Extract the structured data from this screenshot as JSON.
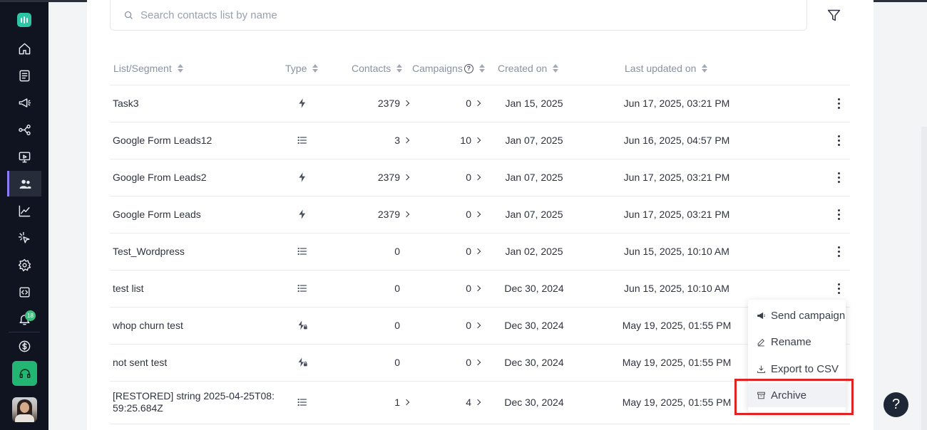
{
  "search": {
    "placeholder": "Search contacts list by name"
  },
  "sidebar": {
    "items": [
      "logo",
      "home",
      "templates",
      "campaigns",
      "automations",
      "pages",
      "contacts",
      "analytics",
      "integrations",
      "settings",
      "developer",
      "notifications",
      "billing",
      "support",
      "profile"
    ],
    "notification_count": "18",
    "active": "contacts"
  },
  "table": {
    "headers": {
      "name": "List/Segment",
      "type": "Type",
      "contacts": "Contacts",
      "campaigns": "Campaigns",
      "created": "Created on",
      "updated": "Last updated on"
    },
    "rows": [
      {
        "name": "Task3",
        "type": "bolt-icon",
        "contacts": "2379",
        "contacts_link": true,
        "campaigns": "0",
        "created": "Jan 15, 2025",
        "updated": "Jun 17, 2025, 03:21 PM"
      },
      {
        "name": "Google Form Leads12",
        "type": "list-icon",
        "contacts": "3",
        "contacts_link": true,
        "campaigns": "10",
        "created": "Jan 07, 2025",
        "updated": "Jun 16, 2025, 04:57 PM"
      },
      {
        "name": "Google From Leads2",
        "type": "bolt-icon",
        "contacts": "2379",
        "contacts_link": true,
        "campaigns": "0",
        "created": "Jan 07, 2025",
        "updated": "Jun 17, 2025, 03:21 PM"
      },
      {
        "name": "Google Form Leads",
        "type": "bolt-icon",
        "contacts": "2379",
        "contacts_link": true,
        "campaigns": "0",
        "created": "Jan 07, 2025",
        "updated": "Jun 17, 2025, 03:21 PM"
      },
      {
        "name": "Test_Wordpress",
        "type": "list-icon",
        "contacts": "0",
        "contacts_link": false,
        "campaigns": "0",
        "created": "Jan 02, 2025",
        "updated": "Jun 15, 2025, 10:10 AM"
      },
      {
        "name": "test list",
        "type": "list-icon",
        "contacts": "0",
        "contacts_link": false,
        "campaigns": "0",
        "created": "Dec 30, 2024",
        "updated": "Jun 15, 2025, 10:10 AM"
      },
      {
        "name": "whop churn test",
        "type": "bolt-lock-icon",
        "contacts": "0",
        "contacts_link": false,
        "campaigns": "0",
        "created": "Dec 30, 2024",
        "updated": "May 19, 2025, 01:55 PM"
      },
      {
        "name": "not sent test",
        "type": "bolt-lock-icon",
        "contacts": "0",
        "contacts_link": false,
        "campaigns": "0",
        "created": "Dec 30, 2024",
        "updated": "May 19, 2025, 01:55 PM"
      },
      {
        "name": "[RESTORED] string 2025-04-25T08: 59:25.684Z",
        "type": "list-icon",
        "contacts": "1",
        "contacts_link": true,
        "campaigns": "4",
        "created": "Dec 30, 2024",
        "updated": "May 19, 2025, 01:55 PM"
      }
    ]
  },
  "context_menu": {
    "items": [
      {
        "label": "Send campaign",
        "icon": "megaphone-icon"
      },
      {
        "label": "Rename",
        "icon": "pencil-icon"
      },
      {
        "label": "Export to CSV",
        "icon": "download-icon"
      },
      {
        "label": "Archive",
        "icon": "archive-icon"
      }
    ],
    "highlighted": "Archive"
  },
  "help_button": {
    "label": "?"
  },
  "colors": {
    "highlight": "#e02424",
    "sidebar_bg": "#0f1420",
    "support_green": "#23b573",
    "active_accent": "#8b7cf6"
  }
}
